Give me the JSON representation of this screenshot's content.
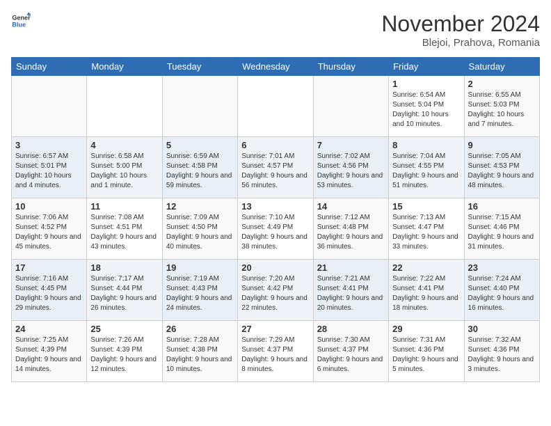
{
  "header": {
    "logo_general": "General",
    "logo_blue": "Blue",
    "month_title": "November 2024",
    "subtitle": "Blejoi, Prahova, Romania"
  },
  "columns": [
    "Sunday",
    "Monday",
    "Tuesday",
    "Wednesday",
    "Thursday",
    "Friday",
    "Saturday"
  ],
  "weeks": [
    [
      {
        "day": "",
        "info": ""
      },
      {
        "day": "",
        "info": ""
      },
      {
        "day": "",
        "info": ""
      },
      {
        "day": "",
        "info": ""
      },
      {
        "day": "",
        "info": ""
      },
      {
        "day": "1",
        "info": "Sunrise: 6:54 AM\nSunset: 5:04 PM\nDaylight: 10 hours and 10 minutes."
      },
      {
        "day": "2",
        "info": "Sunrise: 6:55 AM\nSunset: 5:03 PM\nDaylight: 10 hours and 7 minutes."
      }
    ],
    [
      {
        "day": "3",
        "info": "Sunrise: 6:57 AM\nSunset: 5:01 PM\nDaylight: 10 hours and 4 minutes."
      },
      {
        "day": "4",
        "info": "Sunrise: 6:58 AM\nSunset: 5:00 PM\nDaylight: 10 hours and 1 minute."
      },
      {
        "day": "5",
        "info": "Sunrise: 6:59 AM\nSunset: 4:58 PM\nDaylight: 9 hours and 59 minutes."
      },
      {
        "day": "6",
        "info": "Sunrise: 7:01 AM\nSunset: 4:57 PM\nDaylight: 9 hours and 56 minutes."
      },
      {
        "day": "7",
        "info": "Sunrise: 7:02 AM\nSunset: 4:56 PM\nDaylight: 9 hours and 53 minutes."
      },
      {
        "day": "8",
        "info": "Sunrise: 7:04 AM\nSunset: 4:55 PM\nDaylight: 9 hours and 51 minutes."
      },
      {
        "day": "9",
        "info": "Sunrise: 7:05 AM\nSunset: 4:53 PM\nDaylight: 9 hours and 48 minutes."
      }
    ],
    [
      {
        "day": "10",
        "info": "Sunrise: 7:06 AM\nSunset: 4:52 PM\nDaylight: 9 hours and 45 minutes."
      },
      {
        "day": "11",
        "info": "Sunrise: 7:08 AM\nSunset: 4:51 PM\nDaylight: 9 hours and 43 minutes."
      },
      {
        "day": "12",
        "info": "Sunrise: 7:09 AM\nSunset: 4:50 PM\nDaylight: 9 hours and 40 minutes."
      },
      {
        "day": "13",
        "info": "Sunrise: 7:10 AM\nSunset: 4:49 PM\nDaylight: 9 hours and 38 minutes."
      },
      {
        "day": "14",
        "info": "Sunrise: 7:12 AM\nSunset: 4:48 PM\nDaylight: 9 hours and 36 minutes."
      },
      {
        "day": "15",
        "info": "Sunrise: 7:13 AM\nSunset: 4:47 PM\nDaylight: 9 hours and 33 minutes."
      },
      {
        "day": "16",
        "info": "Sunrise: 7:15 AM\nSunset: 4:46 PM\nDaylight: 9 hours and 31 minutes."
      }
    ],
    [
      {
        "day": "17",
        "info": "Sunrise: 7:16 AM\nSunset: 4:45 PM\nDaylight: 9 hours and 29 minutes."
      },
      {
        "day": "18",
        "info": "Sunrise: 7:17 AM\nSunset: 4:44 PM\nDaylight: 9 hours and 26 minutes."
      },
      {
        "day": "19",
        "info": "Sunrise: 7:19 AM\nSunset: 4:43 PM\nDaylight: 9 hours and 24 minutes."
      },
      {
        "day": "20",
        "info": "Sunrise: 7:20 AM\nSunset: 4:42 PM\nDaylight: 9 hours and 22 minutes."
      },
      {
        "day": "21",
        "info": "Sunrise: 7:21 AM\nSunset: 4:41 PM\nDaylight: 9 hours and 20 minutes."
      },
      {
        "day": "22",
        "info": "Sunrise: 7:22 AM\nSunset: 4:41 PM\nDaylight: 9 hours and 18 minutes."
      },
      {
        "day": "23",
        "info": "Sunrise: 7:24 AM\nSunset: 4:40 PM\nDaylight: 9 hours and 16 minutes."
      }
    ],
    [
      {
        "day": "24",
        "info": "Sunrise: 7:25 AM\nSunset: 4:39 PM\nDaylight: 9 hours and 14 minutes."
      },
      {
        "day": "25",
        "info": "Sunrise: 7:26 AM\nSunset: 4:39 PM\nDaylight: 9 hours and 12 minutes."
      },
      {
        "day": "26",
        "info": "Sunrise: 7:28 AM\nSunset: 4:38 PM\nDaylight: 9 hours and 10 minutes."
      },
      {
        "day": "27",
        "info": "Sunrise: 7:29 AM\nSunset: 4:37 PM\nDaylight: 9 hours and 8 minutes."
      },
      {
        "day": "28",
        "info": "Sunrise: 7:30 AM\nSunset: 4:37 PM\nDaylight: 9 hours and 6 minutes."
      },
      {
        "day": "29",
        "info": "Sunrise: 7:31 AM\nSunset: 4:36 PM\nDaylight: 9 hours and 5 minutes."
      },
      {
        "day": "30",
        "info": "Sunrise: 7:32 AM\nSunset: 4:36 PM\nDaylight: 9 hours and 3 minutes."
      }
    ]
  ]
}
